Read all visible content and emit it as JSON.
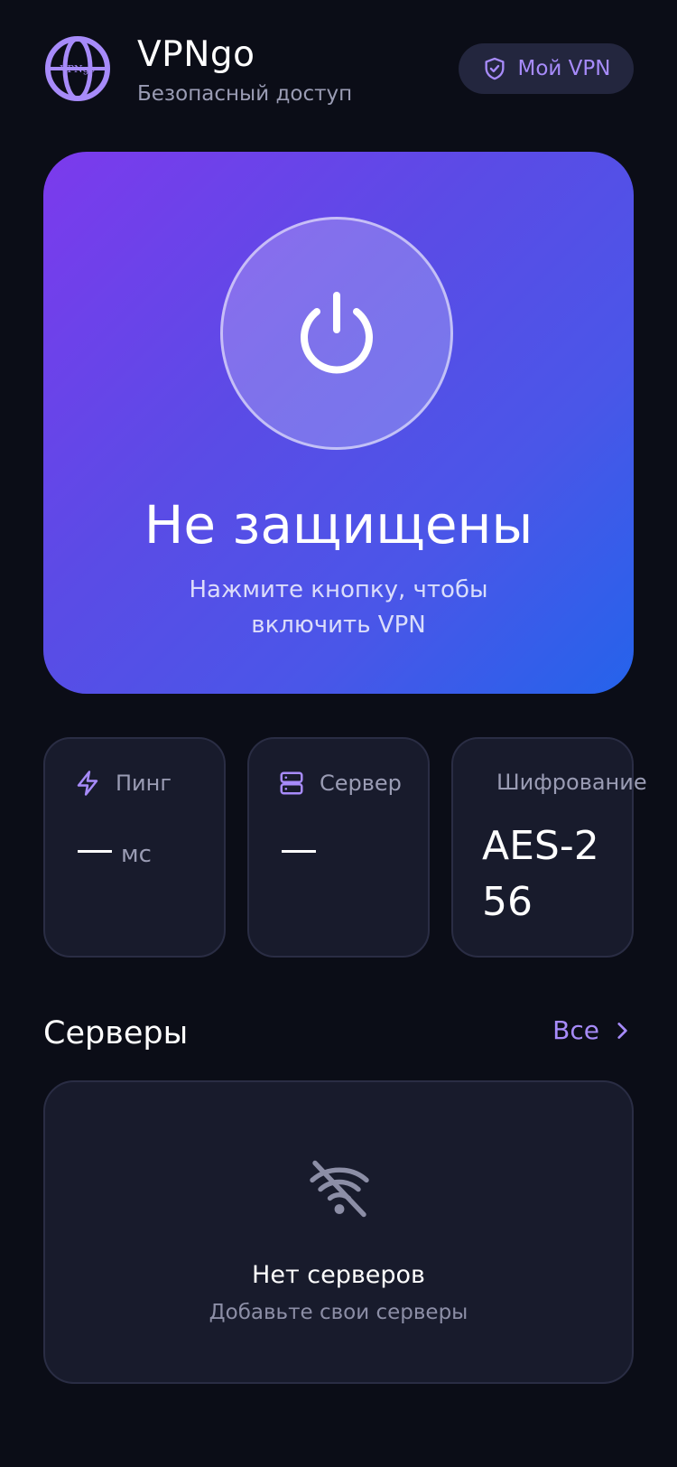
{
  "header": {
    "app_name": "VPNgo",
    "subtitle": "Безопасный доступ",
    "logo_text": "VPNgo",
    "my_vpn_label": "Мой VPN"
  },
  "hero": {
    "status_title": "Не защищены",
    "status_hint": "Нажмите кнопку, чтобы включить VPN"
  },
  "stats": {
    "ping": {
      "label": "Пинг",
      "value": "—",
      "unit": "мс"
    },
    "server": {
      "label": "Сервер",
      "value": "—"
    },
    "encryption": {
      "label": "Шифрование",
      "value": "AES-256"
    }
  },
  "servers": {
    "section_title": "Серверы",
    "see_all_label": "Все",
    "empty_title": "Нет серверов",
    "empty_hint": "Добавьте свои серверы"
  },
  "colors": {
    "background": "#0b0d17",
    "card": "#181b2c",
    "accent": "#a78bfa",
    "gradient_start": "#7c3aed",
    "gradient_end": "#2563eb"
  },
  "icons": [
    "globe-logo-icon",
    "shield-check-icon",
    "power-icon",
    "lightning-icon",
    "server-icon",
    "chevron-right-icon",
    "wifi-off-icon"
  ]
}
